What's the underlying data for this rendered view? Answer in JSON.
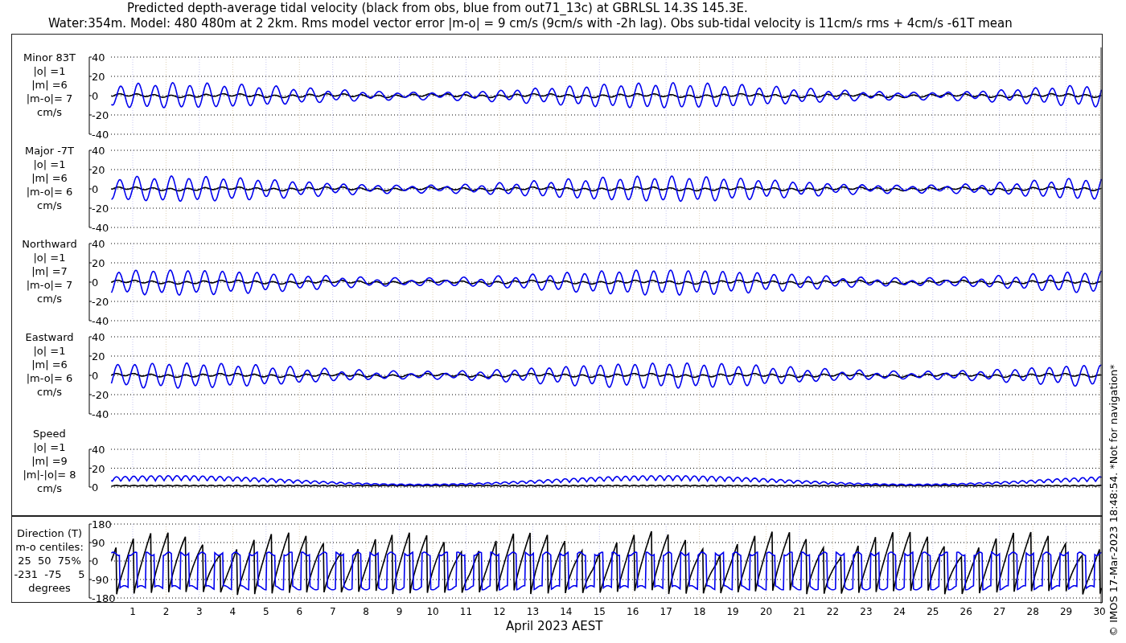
{
  "title_lines": [
    "Predicted depth-average tidal velocity (black from obs, blue from out71_13c) at GBRLSL 14.3S 145.3E.",
    "Water:354m. Model: 480 480m at 2 2km. Rms model vector error |m-o| = 9 cm/s (9cm/s with -2h lag). Obs sub-tidal velocity is 11cm/s rms + 4cm/s -61T mean"
  ],
  "panels": [
    {
      "kind": "velocity",
      "label_lines": [
        "Minor 83T",
        "|o| =1",
        "|m| =6",
        "|m-o|= 7",
        "cm/s"
      ],
      "y_tick_labels": [
        "40",
        "20",
        "0",
        "-20",
        "-40"
      ]
    },
    {
      "kind": "velocity",
      "label_lines": [
        "Major -7T",
        "|o| =1",
        "|m| =6",
        "|m-o|= 6",
        "cm/s"
      ],
      "y_tick_labels": [
        "40",
        "20",
        "0",
        "-20",
        "-40"
      ]
    },
    {
      "kind": "velocity",
      "label_lines": [
        "Northward",
        "|o| =1",
        "|m| =7",
        "|m-o|= 7",
        "cm/s"
      ],
      "y_tick_labels": [
        "40",
        "20",
        "0",
        "-20",
        "-40"
      ]
    },
    {
      "kind": "velocity",
      "label_lines": [
        "Eastward",
        "|o| =1",
        "|m| =6",
        "|m-o|= 6",
        "cm/s"
      ],
      "y_tick_labels": [
        "40",
        "20",
        "0",
        "-20",
        "-40"
      ]
    },
    {
      "kind": "speed",
      "label_lines": [
        "Speed",
        "|o| =1",
        "|m| =9",
        "|m|-|o|= 8",
        "cm/s"
      ],
      "y_tick_labels": [
        "40",
        "20",
        "0"
      ]
    },
    {
      "kind": "direction",
      "label_lines": [
        "Direction (T)",
        "m-o centiles:",
        "25  50  75%",
        "-231  -75     5",
        "degrees"
      ],
      "y_tick_labels": [
        "180",
        "90",
        "0",
        "-90",
        "-180"
      ]
    }
  ],
  "x_tick_labels": [
    "1",
    "2",
    "3",
    "4",
    "5",
    "6",
    "7",
    "8",
    "9",
    "10",
    "11",
    "12",
    "13",
    "14",
    "15",
    "16",
    "17",
    "18",
    "19",
    "20",
    "21",
    "22",
    "23",
    "24",
    "25",
    "26",
    "27",
    "28",
    "29",
    "30"
  ],
  "xlabel": "April 2023 AEST",
  "credit": "© IMOS 17-Mar-2023 18:48:54. *Not for navigation*"
}
